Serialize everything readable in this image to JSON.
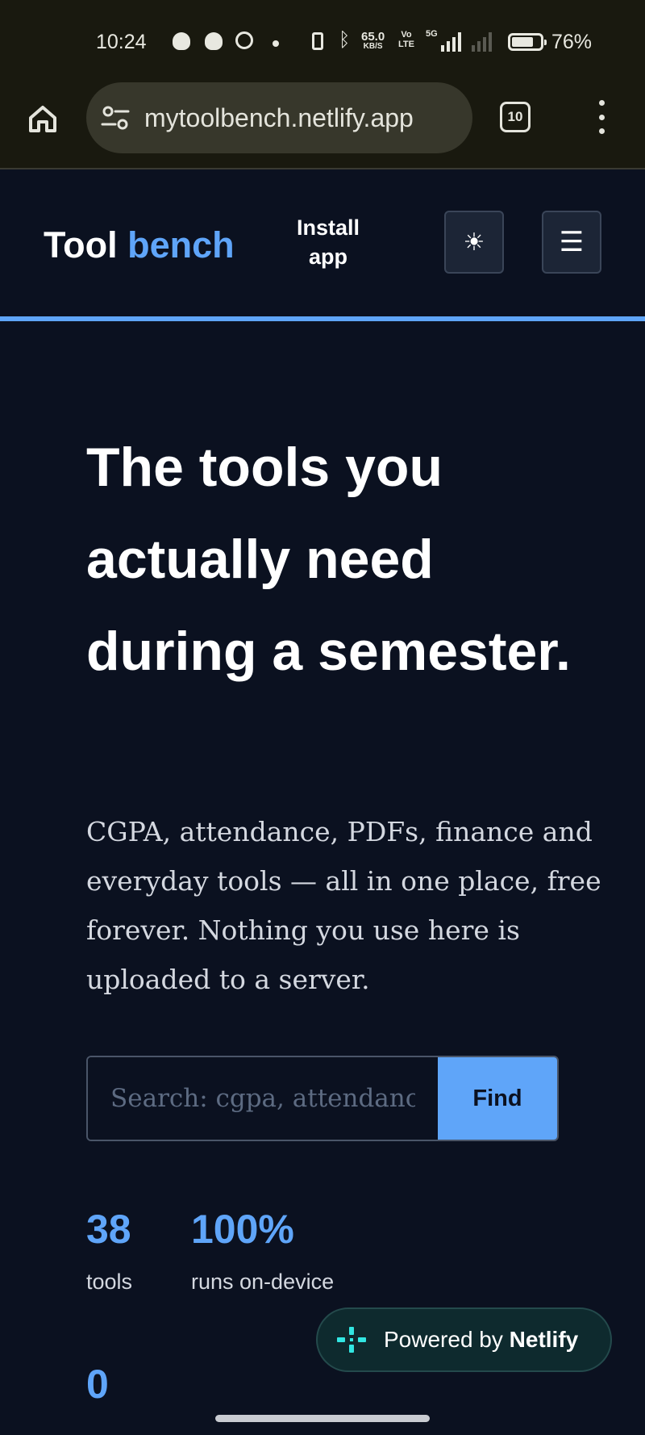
{
  "status_bar": {
    "time": "10:24",
    "net_speed_value": "65.0",
    "net_speed_unit": "KB/S",
    "volte_top": "Vo",
    "volte_bottom": "LTE",
    "network_type": "5G",
    "battery_percent": "76%",
    "battery_level": 0.76,
    "icons": [
      "snapchat-icon",
      "snapchat-icon",
      "whatsapp-icon",
      "dot-icon",
      "vibrate-icon",
      "bluetooth-icon",
      "signal-icon",
      "signal-icon",
      "battery-icon"
    ]
  },
  "browser": {
    "url": "mytoolbench.netlify.app",
    "tab_count": "10"
  },
  "header": {
    "logo_primary": "Tool",
    "logo_accent": "bench",
    "install_line1": "Install",
    "install_line2": "app",
    "theme_icon_glyph": "☀",
    "menu_icon_glyph": "☰"
  },
  "hero": {
    "title": "The tools you actually need during a semester.",
    "description": "CGPA, attendance, PDFs, finance and everyday tools — all in one place, free forever. Nothing you use here is uploaded to a server."
  },
  "search": {
    "placeholder": "Search: cgpa, attendance, pdf…",
    "button_label": "Find"
  },
  "stats": [
    {
      "value": "38",
      "label": "tools"
    },
    {
      "value": "100%",
      "label": "runs on-device"
    },
    {
      "value": "0",
      "label": ""
    }
  ],
  "badge": {
    "prefix": "Powered by",
    "brand": "Netlify"
  },
  "colors": {
    "background": "#0b1120",
    "accent": "#5fa5f9",
    "browser_chrome": "#19190f",
    "badge_bg": "#0e2a2e",
    "netlify_teal": "#32e6e2"
  }
}
